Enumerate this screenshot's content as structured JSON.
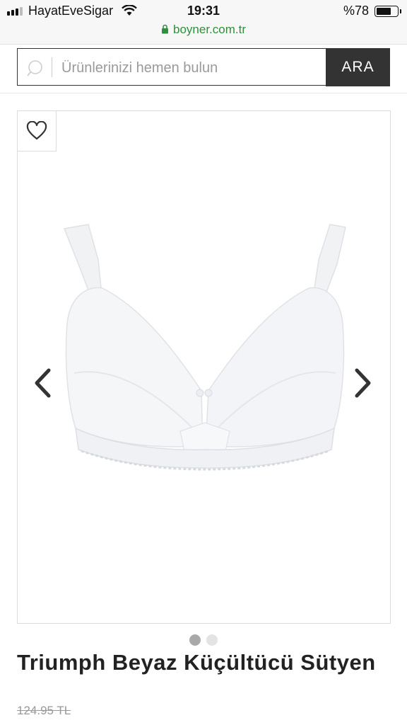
{
  "status_bar": {
    "carrier": "HayatEveSigar",
    "time": "19:31",
    "battery_percent": "%78",
    "battery_level": 0.78,
    "url": "boyner.com.tr"
  },
  "search": {
    "placeholder": "Ürünlerinizi hemen bulun",
    "button_label": "ARA"
  },
  "product": {
    "title": "Triumph Beyaz Küçültücü Sütyen",
    "old_price": "124.95 TL",
    "image_count": 2,
    "active_image_index": 0
  },
  "icons": {
    "favorite": "heart-outline-icon",
    "prev": "chevron-left-icon",
    "next": "chevron-right-icon",
    "search": "search-icon",
    "lock": "lock-icon"
  },
  "colors": {
    "url_green": "#2f8f3c",
    "button_dark": "#333333",
    "text": "#222222",
    "muted": "#9a9a9a"
  }
}
